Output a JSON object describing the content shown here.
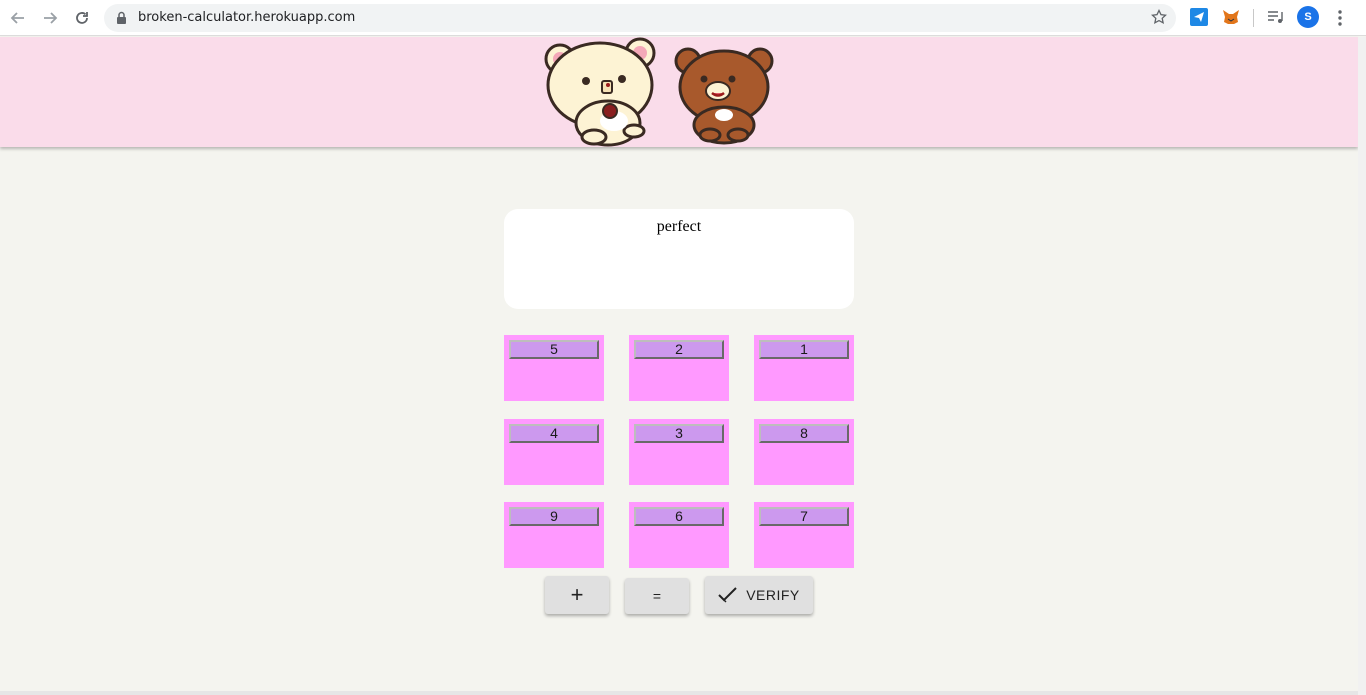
{
  "browser": {
    "url": "broken-calculator.herokuapp.com",
    "profile_initial": "S",
    "icons": {
      "back": "arrow-left-icon",
      "forward": "arrow-right-icon",
      "reload": "reload-icon",
      "lock": "lock-icon",
      "bookmark": "star-icon",
      "extension1": "paper-plane-extension-icon",
      "extension2": "metamask-fox-icon",
      "media": "media-queue-icon",
      "menu": "kebab-menu-icon"
    }
  },
  "banner": {
    "background": "#fadcea",
    "image": "two-bears-illustration"
  },
  "display": {
    "text": "perfect"
  },
  "keypad": {
    "rows": [
      [
        "5",
        "2",
        "1"
      ],
      [
        "4",
        "3",
        "8"
      ],
      [
        "9",
        "6",
        "7"
      ]
    ],
    "tile_color": "#ff99ff",
    "button_color": "#cc99ee"
  },
  "actions": {
    "plus_label": "+",
    "equals_label": "=",
    "verify_label": "VERIFY",
    "verify_icon": "check-icon"
  }
}
